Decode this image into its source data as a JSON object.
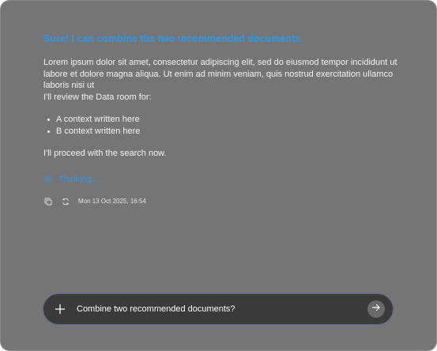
{
  "message": {
    "headline": "Sure! I can combine the two recommended documents.",
    "intro": "Lorem ipsum dolor sit amet, consectetur adipiscing elit, sed do eiusmod tempor incididunt ut labore et dolore magna aliqua. Ut enim ad minim veniam, quis nostrud exercitation ullamco laboris nisi ut",
    "review": "I'll review the Data room for:",
    "bullets": [
      "A context written here",
      "B context written here"
    ],
    "proceed": "I'll proceed with the search now."
  },
  "status": {
    "thinking_label": "Thinking...",
    "thinking_icon": "sun-spinner-icon"
  },
  "meta": {
    "timestamp": "Mon 13 Oct 2025, 16:54",
    "copy_icon": "copy-icon",
    "regenerate_icon": "refresh-icon"
  },
  "composer": {
    "text": "Combine two recommended documents?",
    "add_icon": "plus-icon",
    "send_icon": "arrow-right-icon"
  },
  "colors": {
    "accent": "#2f9ae8",
    "panel": "#757575",
    "composer_bg": "#3a3a3a"
  }
}
